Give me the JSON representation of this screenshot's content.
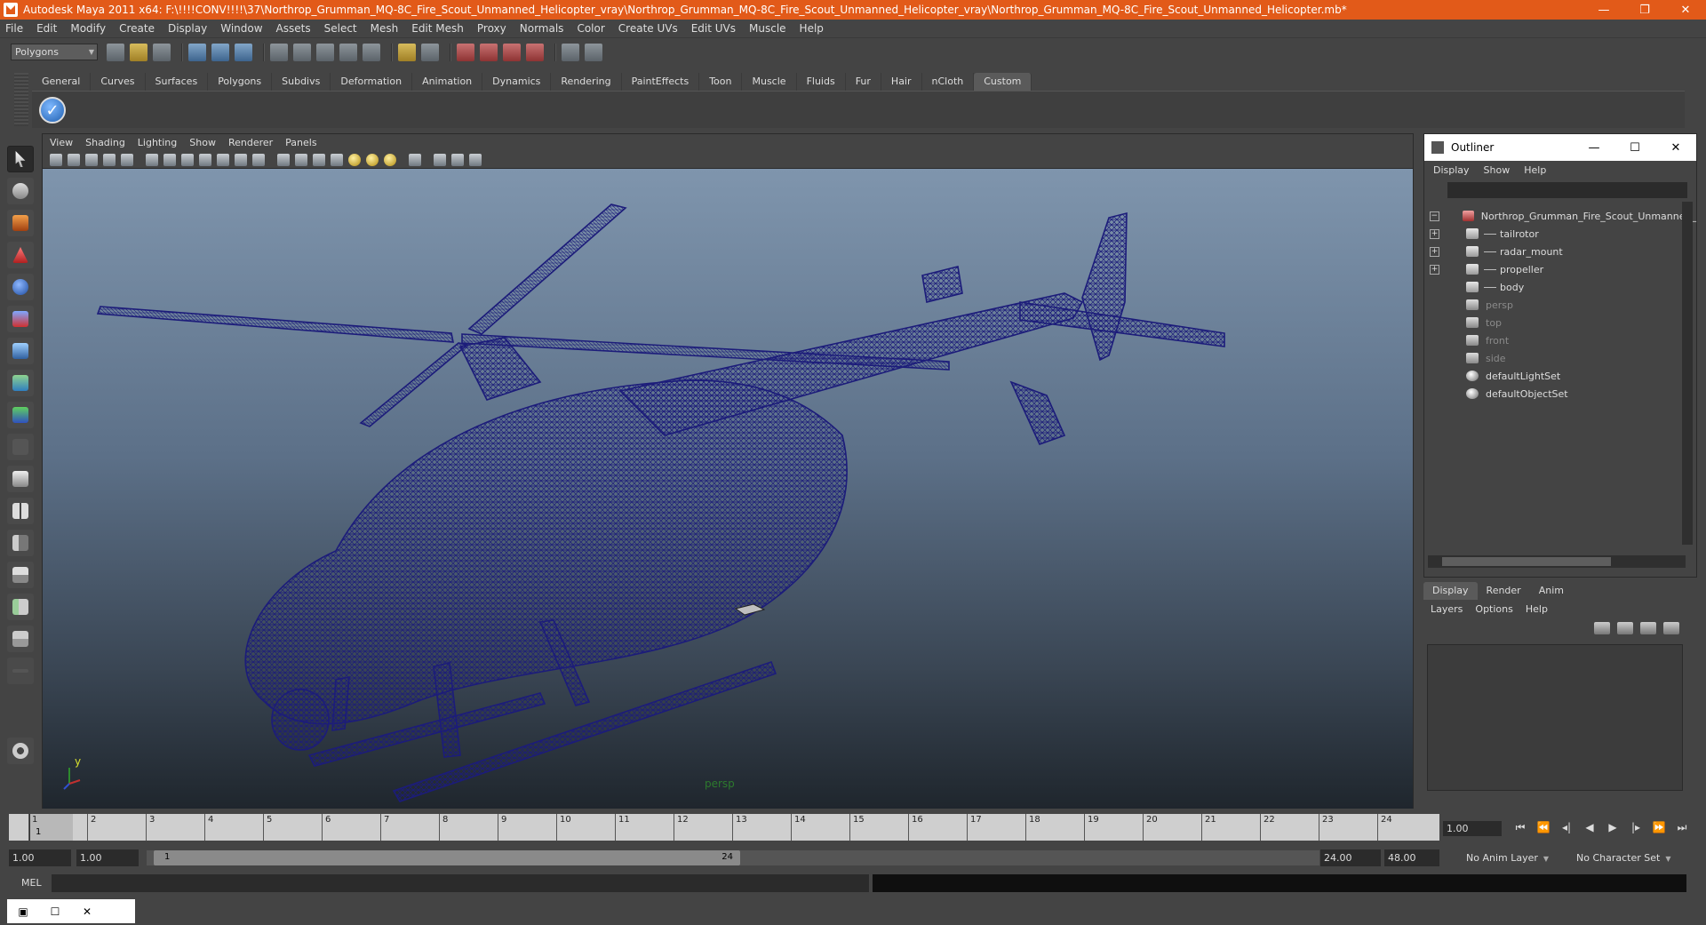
{
  "window": {
    "title": "Autodesk Maya 2011 x64: F:\\!!!!CONV!!!!\\37\\Northrop_Grumman_MQ-8C_Fire_Scout_Unmanned_Helicopter_vray\\Northrop_Grumman_MQ-8C_Fire_Scout_Unmanned_Helicopter_vray\\Northrop_Grumman_MQ-8C_Fire_Scout_Unmanned_Helicopter.mb*",
    "accent_color": "#e25a19"
  },
  "menubar": [
    "File",
    "Edit",
    "Modify",
    "Create",
    "Display",
    "Window",
    "Assets",
    "Select",
    "Mesh",
    "Edit Mesh",
    "Proxy",
    "Normals",
    "Color",
    "Create UVs",
    "Edit UVs",
    "Muscle",
    "Help"
  ],
  "statusline": {
    "mode": "Polygons"
  },
  "shelf": {
    "tabs": [
      "General",
      "Curves",
      "Surfaces",
      "Polygons",
      "Subdivs",
      "Deformation",
      "Animation",
      "Dynamics",
      "Rendering",
      "PaintEffects",
      "Toon",
      "Muscle",
      "Fluids",
      "Fur",
      "Hair",
      "nCloth",
      "Custom"
    ],
    "active_tab": "Custom"
  },
  "viewport": {
    "menu": [
      "View",
      "Shading",
      "Lighting",
      "Show",
      "Renderer",
      "Panels"
    ],
    "camera": "persp",
    "axis_y": "y",
    "wireframe_color": "#1c1c7a"
  },
  "outliner": {
    "title": "Outliner",
    "menu": [
      "Display",
      "Show",
      "Help"
    ],
    "items": [
      {
        "label": "Northrop_Grumman_Fire_Scout_Unmanned_",
        "kind": "root"
      },
      {
        "label": "tailrotor",
        "kind": "child"
      },
      {
        "label": "radar_mount",
        "kind": "child"
      },
      {
        "label": "propeller",
        "kind": "child"
      },
      {
        "label": "body",
        "kind": "child"
      },
      {
        "label": "persp",
        "kind": "camera"
      },
      {
        "label": "top",
        "kind": "camera"
      },
      {
        "label": "front",
        "kind": "camera"
      },
      {
        "label": "side",
        "kind": "camera"
      },
      {
        "label": "defaultLightSet",
        "kind": "set"
      },
      {
        "label": "defaultObjectSet",
        "kind": "set"
      }
    ]
  },
  "layers": {
    "tabs": [
      "Display",
      "Render",
      "Anim"
    ],
    "active_tab": "Display",
    "menu": [
      "Layers",
      "Options",
      "Help"
    ]
  },
  "timeline": {
    "ticks": [
      "1",
      "2",
      "3",
      "4",
      "5",
      "6",
      "7",
      "8",
      "9",
      "10",
      "11",
      "12",
      "13",
      "14",
      "15",
      "16",
      "17",
      "18",
      "19",
      "20",
      "21",
      "22",
      "23",
      "24"
    ],
    "current_frame_marker": "1",
    "current_time": "1.00"
  },
  "range": {
    "start": "1.00",
    "playback_start": "1.00",
    "handle_start": "1",
    "handle_end": "24",
    "playback_end": "24.00",
    "end": "48.00",
    "anim_layer": "No Anim Layer",
    "character_set": "No Character Set"
  },
  "cmdline": {
    "label": "MEL"
  }
}
